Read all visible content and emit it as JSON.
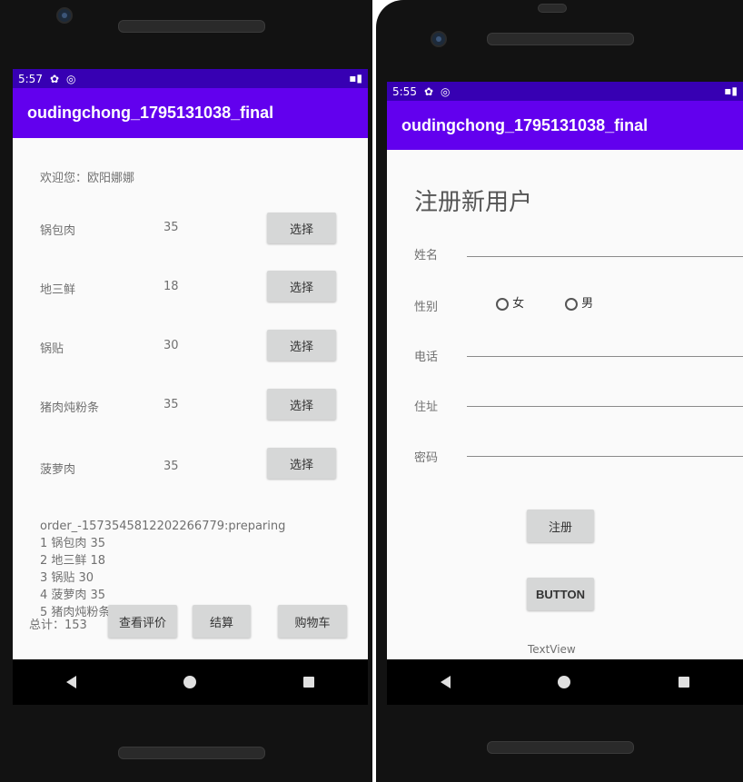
{
  "left": {
    "status": {
      "time": "5:57"
    },
    "app_title": "oudingchong_1795131038_final",
    "welcome": "欢迎您：欧阳娜娜",
    "menu": [
      {
        "name": "锅包肉",
        "price": "35",
        "button": "选择"
      },
      {
        "name": "地三鲜",
        "price": "18",
        "button": "选择"
      },
      {
        "name": "锅贴",
        "price": "30",
        "button": "选择"
      },
      {
        "name": "猪肉炖粉条",
        "price": "35",
        "button": "选择"
      },
      {
        "name": "菠萝肉",
        "price": "35",
        "button": "选择"
      }
    ],
    "order": {
      "id_line": "order_-1573545812202266779:preparing",
      "lines": [
        "1 锅包肉 35",
        "2 地三鲜 18",
        "3 锅贴 30",
        "4 菠萝肉 35",
        "5 猪肉炖粉条"
      ]
    },
    "total": "总计：153",
    "buttons": {
      "review": "查看评价",
      "checkout": "结算",
      "cart": "购物车"
    }
  },
  "right": {
    "status": {
      "time": "5:55"
    },
    "app_title": "oudingchong_1795131038_final",
    "heading": "注册新用户",
    "fields": {
      "name": "姓名",
      "gender": "性别",
      "phone": "电话",
      "address": "住址",
      "password": "密码"
    },
    "gender_options": {
      "female": "女",
      "male": "男"
    },
    "register_button": "注册",
    "button2": "BUTTON",
    "textview": "TextView"
  },
  "colors": {
    "app_bar": "#6200ee",
    "status_bar": "#3700b3",
    "button_bg": "#d6d7d7",
    "screen_bg": "#fafafa"
  }
}
